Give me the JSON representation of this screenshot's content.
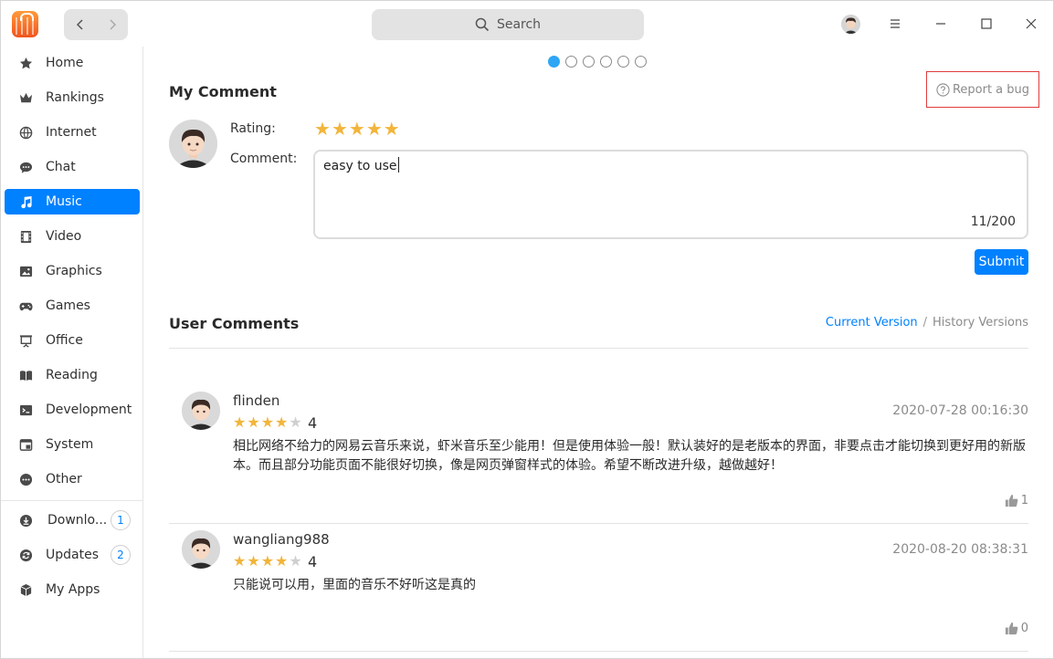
{
  "titlebar": {
    "search_label": "Search"
  },
  "sidebar": {
    "items": [
      {
        "label": "Home",
        "icon": "star-icon"
      },
      {
        "label": "Rankings",
        "icon": "crown-icon"
      },
      {
        "label": "Internet",
        "icon": "globe-icon"
      },
      {
        "label": "Chat",
        "icon": "chat-icon"
      },
      {
        "label": "Music",
        "icon": "music-note-icon",
        "active": true
      },
      {
        "label": "Video",
        "icon": "film-icon"
      },
      {
        "label": "Graphics",
        "icon": "image-icon"
      },
      {
        "label": "Games",
        "icon": "gamepad-icon"
      },
      {
        "label": "Office",
        "icon": "presentation-icon"
      },
      {
        "label": "Reading",
        "icon": "book-icon"
      },
      {
        "label": "Development",
        "icon": "terminal-icon"
      },
      {
        "label": "System",
        "icon": "system-window-icon"
      },
      {
        "label": "Other",
        "icon": "more-dots-icon"
      }
    ],
    "bottom_items": [
      {
        "label": "Downlo...",
        "icon": "download-icon",
        "badge": "1"
      },
      {
        "label": "Updates",
        "icon": "refresh-icon",
        "badge": "2"
      },
      {
        "label": "My Apps",
        "icon": "package-icon"
      }
    ],
    "accent_color": "#0081ff"
  },
  "carousel": {
    "count": 6,
    "active_index": 0
  },
  "my_comment": {
    "title": "My Comment",
    "report_bug_label": "Report a bug",
    "rating_label": "Rating:",
    "rating": 5,
    "comment_label": "Comment:",
    "comment_value": "easy to use",
    "char_count": "11/200",
    "submit_label": "Submit"
  },
  "user_comments": {
    "title": "User Comments",
    "current_version_label": "Current Version",
    "separator": "/",
    "history_versions_label": "History Versions",
    "items": [
      {
        "user": "flinden",
        "rating": 4,
        "score": "4",
        "date": "2020-07-28 00:16:30",
        "text": "相比网络不给力的网易云音乐来说，虾米音乐至少能用！但是使用体验一般！默认装好的是老版本的界面，非要点击才能切换到更好用的新版本。而且部分功能页面不能很好切换，像是网页弹窗样式的体验。希望不断改进升级，越做越好！",
        "likes": "1"
      },
      {
        "user": "wangliang988",
        "rating": 4,
        "score": "4",
        "date": "2020-08-20 08:38:31",
        "text": "只能说可以用，里面的音乐不好听这是真的",
        "likes": "0"
      }
    ]
  }
}
